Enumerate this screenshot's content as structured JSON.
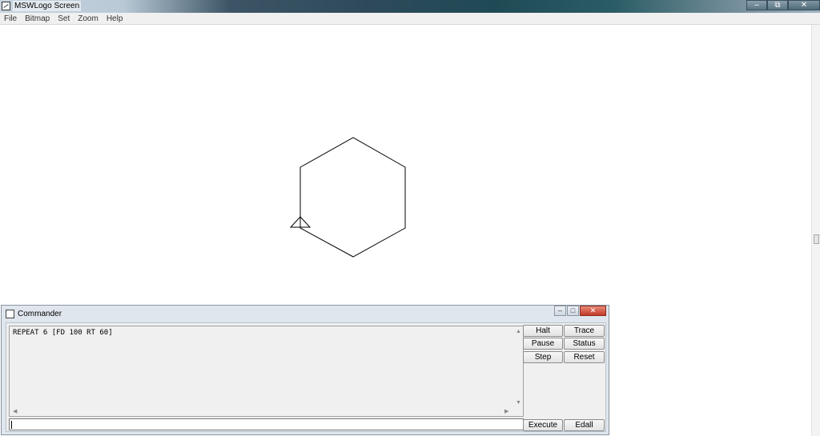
{
  "window": {
    "title": "MSWLogo Screen",
    "controls": {
      "minimize": "–",
      "restore": "⧉",
      "close": "✕"
    }
  },
  "menubar": {
    "items": [
      {
        "label": "File"
      },
      {
        "label": "Bitmap"
      },
      {
        "label": "Set"
      },
      {
        "label": "Zoom"
      },
      {
        "label": "Help"
      }
    ]
  },
  "canvas": {
    "drawing": "hexagon",
    "turtle": "triangle-turtle",
    "stroke_color": "#000000",
    "background": "#ffffff"
  },
  "commander": {
    "title": "Commander",
    "controls": {
      "minimize": "–",
      "restore": "□",
      "close": "✕"
    },
    "history_text": "REPEAT 6 [FD 100 RT 60]",
    "input_value": "",
    "buttons": {
      "halt": "Halt",
      "trace": "Trace",
      "pause": "Pause",
      "status": "Status",
      "step": "Step",
      "reset": "Reset",
      "execute": "Execute",
      "edall": "Edall"
    }
  }
}
